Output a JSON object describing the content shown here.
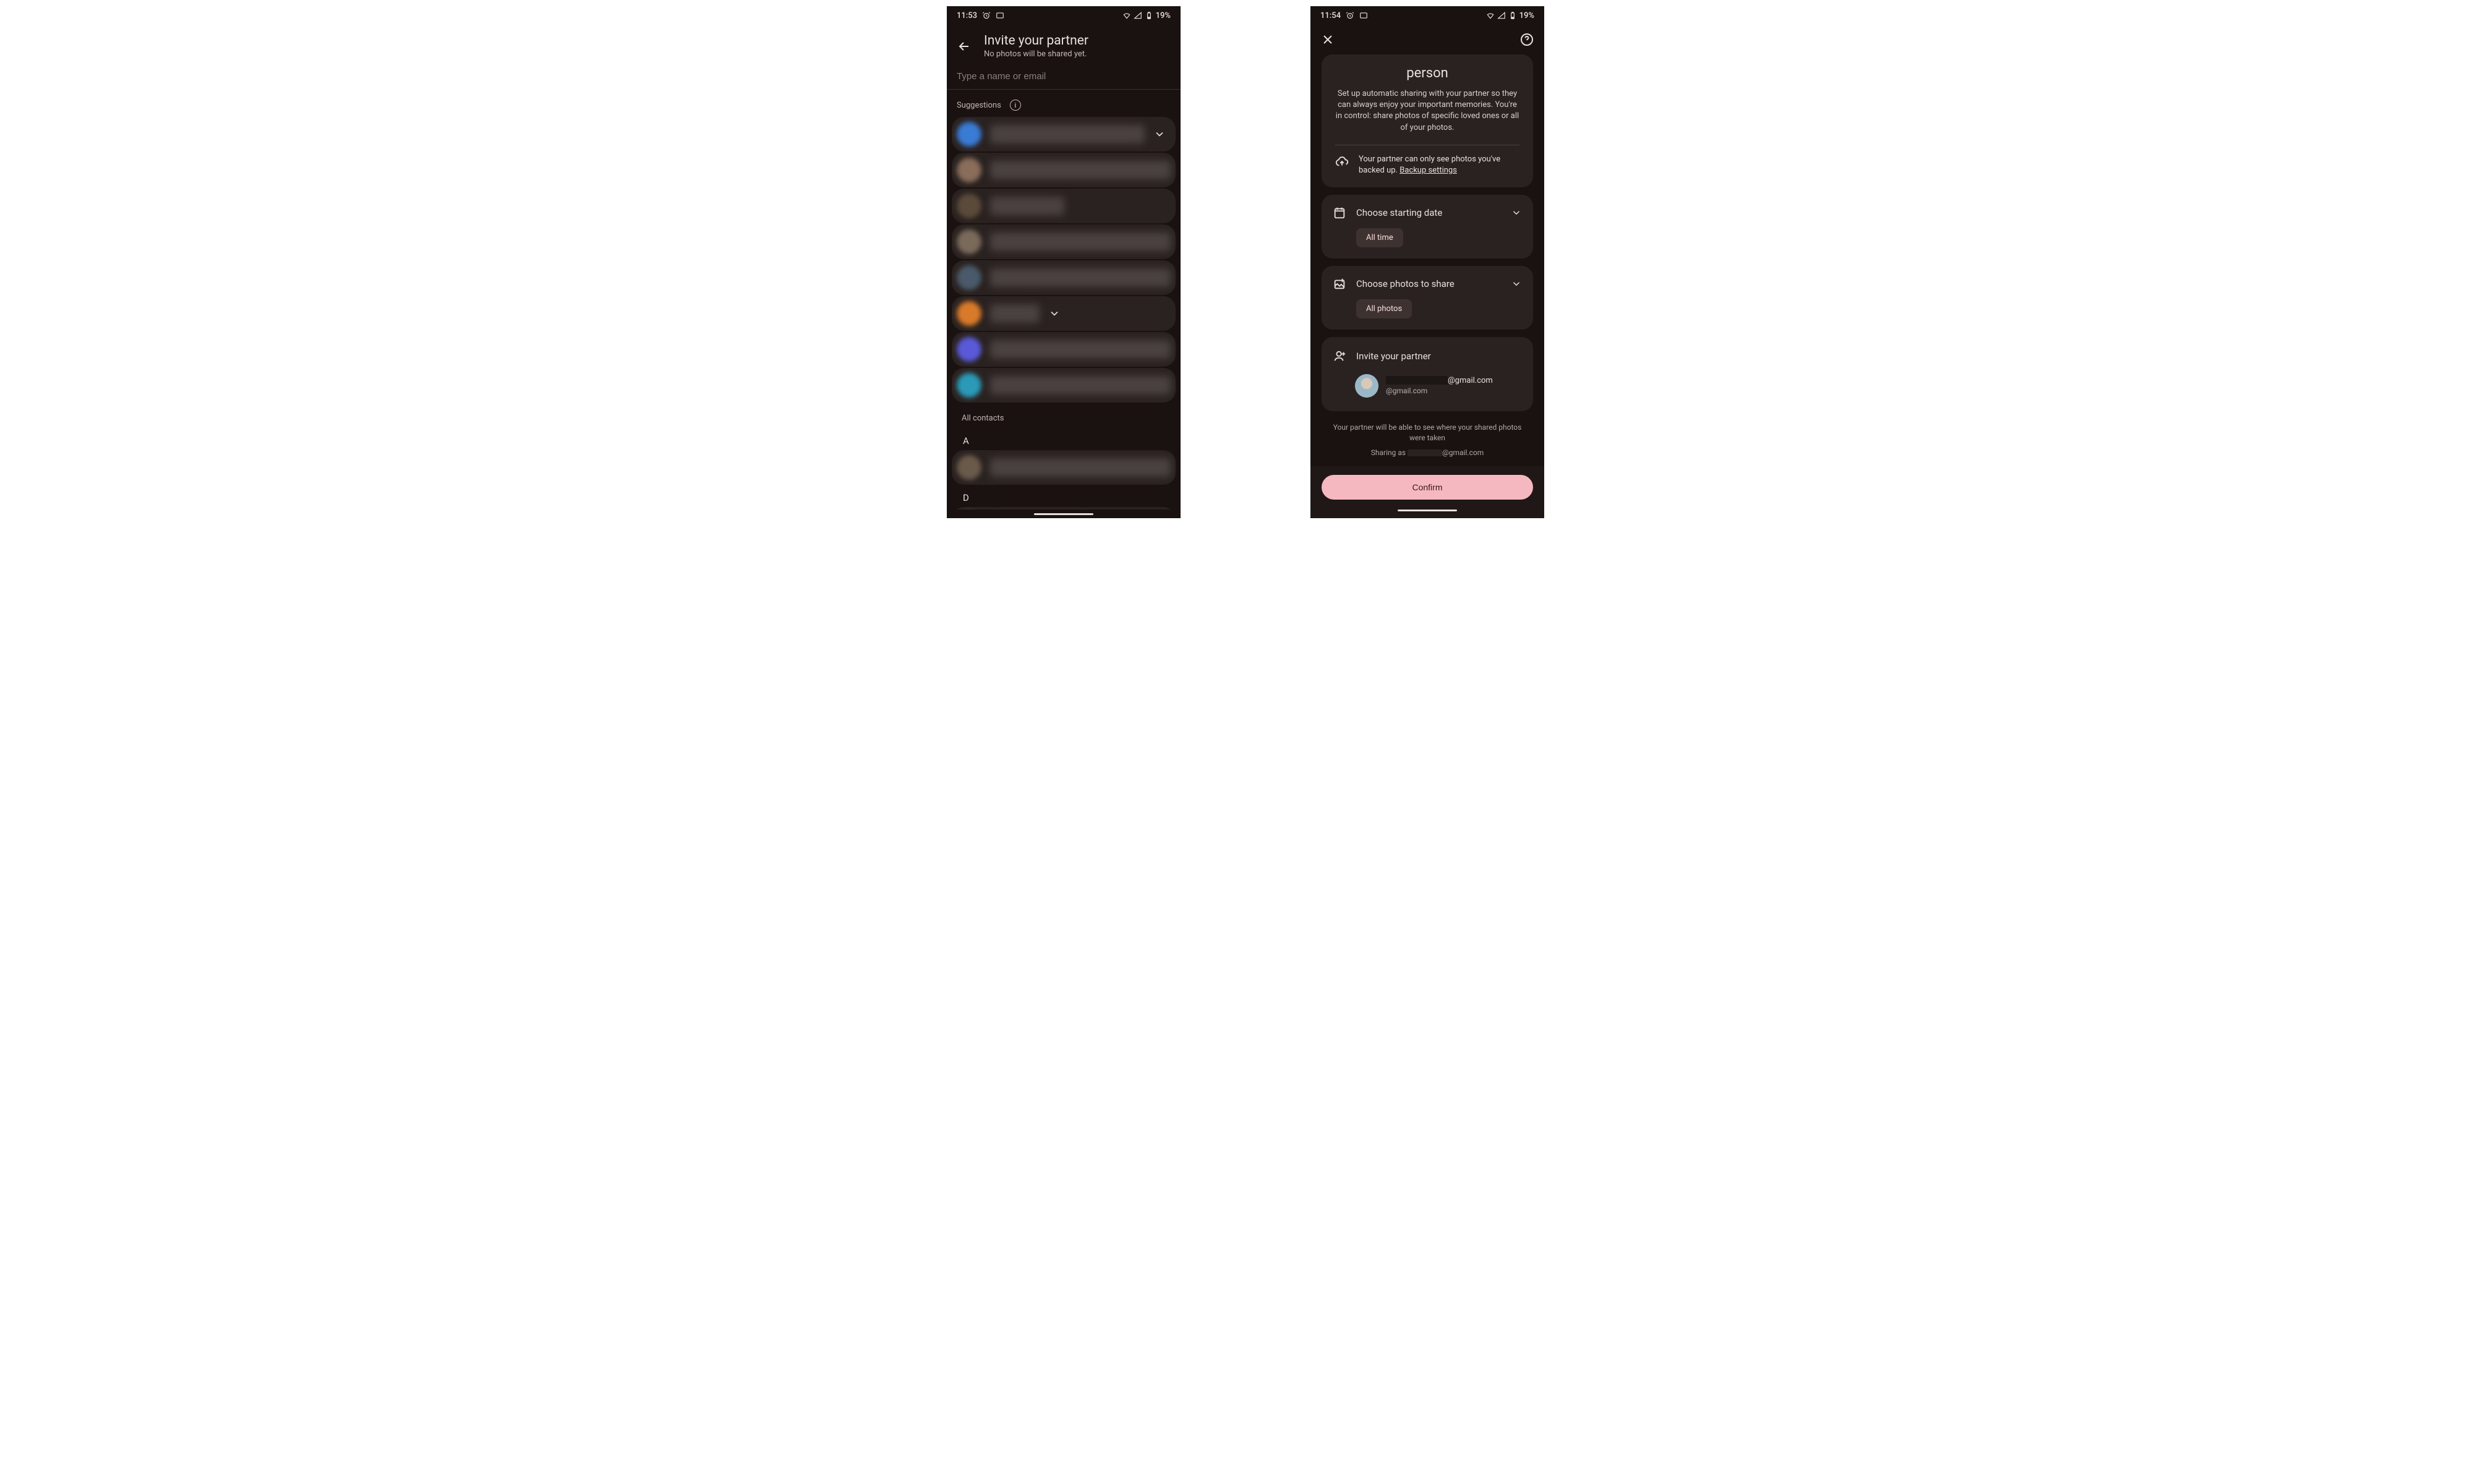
{
  "screen1": {
    "status": {
      "time": "11:53",
      "battery_pct": "19%"
    },
    "header": {
      "title": "Invite your partner",
      "subtitle": "No photos will be shared yet."
    },
    "search_placeholder": "Type a name or email",
    "suggestions_label": "Suggestions",
    "all_contacts_label": "All contacts",
    "letter_a": "A",
    "letter_d": "D",
    "suggestion_avatars": [
      "#3a7bd5",
      "#8a6d5a",
      "#5a4a3a",
      "#7a6a5a",
      "#4a5a6a",
      "#d97a2a",
      "#5a5ad9",
      "#2a9ab8"
    ]
  },
  "screen2": {
    "status": {
      "time": "11:54",
      "battery_pct": "19%"
    },
    "intro": {
      "title_visible": "person",
      "description": "Set up automatic sharing with your partner so they can always enjoy your important memories. You're in control: share photos of specific loved ones or all of your photos.",
      "backup_note": "Your partner can only see photos you've backed up.",
      "backup_link": "Backup settings"
    },
    "date_section": {
      "title": "Choose starting date",
      "chip": "All time"
    },
    "photos_section": {
      "title": "Choose photos to share",
      "chip": "All photos"
    },
    "invite_section": {
      "title": "Invite your partner",
      "email_suffix": "@gmail.com",
      "email_sub_suffix": "@gmail.com"
    },
    "footer": {
      "note": "Your partner will be able to see where your shared photos were taken",
      "sharing_as_prefix": "Sharing as ",
      "sharing_as_suffix": "@gmail.com"
    },
    "confirm_label": "Confirm"
  }
}
